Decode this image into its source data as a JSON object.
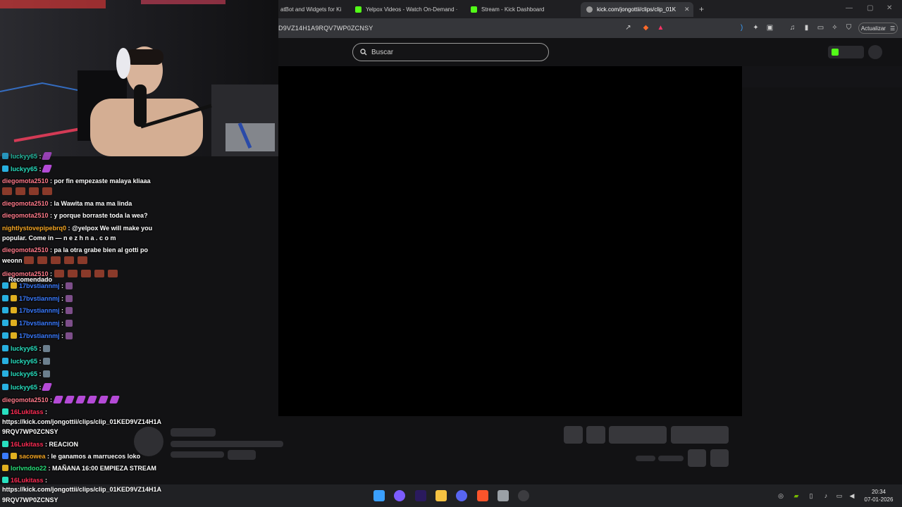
{
  "browser": {
    "tabs": [
      {
        "title": "atBot and Widgets for Ki",
        "color": "#888888"
      },
      {
        "title": "Yelpox Videos - Watch On-Demand ·",
        "color": "#53fc18"
      },
      {
        "title": "Stream - Kick Dashboard",
        "color": "#53fc18"
      },
      {
        "title": "kick.com/jongottii/clips/clip_01K",
        "color": "#cccccc"
      }
    ],
    "new_tab": "+",
    "url": "D9VZ14H1A9RQV7WP0ZCNSY",
    "update_label": "Actualizar",
    "menu_icon": "☰"
  },
  "page": {
    "search_placeholder": "Buscar",
    "recommended_label": "Recomendado"
  },
  "chat": [
    {
      "user": "luckyy65",
      "text": "",
      "emotes": "purple1",
      "color": "#28e0c0",
      "top": 0
    },
    {
      "user": "luckyy65",
      "text": "",
      "emotes": "purple1",
      "color": "#28e0c0",
      "top": 1
    },
    {
      "user": "diegomota2510",
      "text": "por fin empezaste malaya kliaaa",
      "color": "#ff7a8a"
    },
    {
      "user": "diegomota2510",
      "text": "la Wawita ma ma ma linda",
      "color": "#ff7a8a"
    },
    {
      "user": "diegomota2510",
      "text": "y porque borraste toda la wea?",
      "color": "#ff7a8a"
    },
    {
      "user": "nightlystovepipebrq0",
      "text": "@yelpox We will make you",
      "color": "#f5a623"
    },
    {
      "continuation": "popular. Come in — n e z h n a . c o m"
    },
    {
      "user": "diegomota2510",
      "text": "pa la otra grabe bien al gotti po",
      "color": "#ff7a8a"
    },
    {
      "continuation": "weonn"
    },
    {
      "user": "diegomota2510",
      "text": "",
      "color": "#ff7a8a"
    },
    {
      "user": "17bvstiannmj",
      "text": "",
      "color": "#3a7bff"
    },
    {
      "user": "17bvstiannmj",
      "text": "",
      "color": "#3a7bff"
    },
    {
      "user": "17bvstiannmj",
      "text": "",
      "color": "#3a7bff"
    },
    {
      "user": "17bvstiannmj",
      "text": "",
      "color": "#3a7bff"
    },
    {
      "user": "17bvstiannmj",
      "text": "",
      "color": "#3a7bff"
    },
    {
      "user": "luckyy65",
      "text": "",
      "color": "#28e0c0"
    },
    {
      "user": "luckyy65",
      "text": "",
      "color": "#28e0c0"
    },
    {
      "user": "luckyy65",
      "text": "",
      "color": "#28e0c0"
    },
    {
      "user": "luckyy65",
      "text": "",
      "color": "#28e0c0"
    },
    {
      "user": "diegomota2510",
      "text": "",
      "color": "#ff7a8a"
    },
    {
      "user": "16Lukitass",
      "text": "",
      "color": "#ff2d55"
    },
    {
      "continuation": "https://kick.com/jongottii/clips/clip_01KED9VZ14H1A"
    },
    {
      "continuation": "9RQV7WP0ZCNSY"
    },
    {
      "user": "16Lukitass",
      "text": "REACION",
      "color": "#ff2d55"
    },
    {
      "user": "sacowea",
      "text": "le ganamos a marruecos loko",
      "color": "#f5a623"
    },
    {
      "user": "lorlvndoo22",
      "text": "MAÑANA 16:00 EMPIEZA STREAM",
      "color": "#28e07a"
    },
    {
      "user": "16Lukitass",
      "text": "",
      "color": "#ff2d55"
    }
  ],
  "bottom_link": {
    "line1": "https://kick.com/jongottii/clips/clip_01KED9VZ14H1A",
    "line2": "9RQV7WP0ZCNSY"
  },
  "taskbar": {
    "clock_time": "20:34",
    "clock_date": "07-01-2026"
  },
  "colors": {
    "kick_green": "#53fc18",
    "accent": "#53fc18"
  }
}
